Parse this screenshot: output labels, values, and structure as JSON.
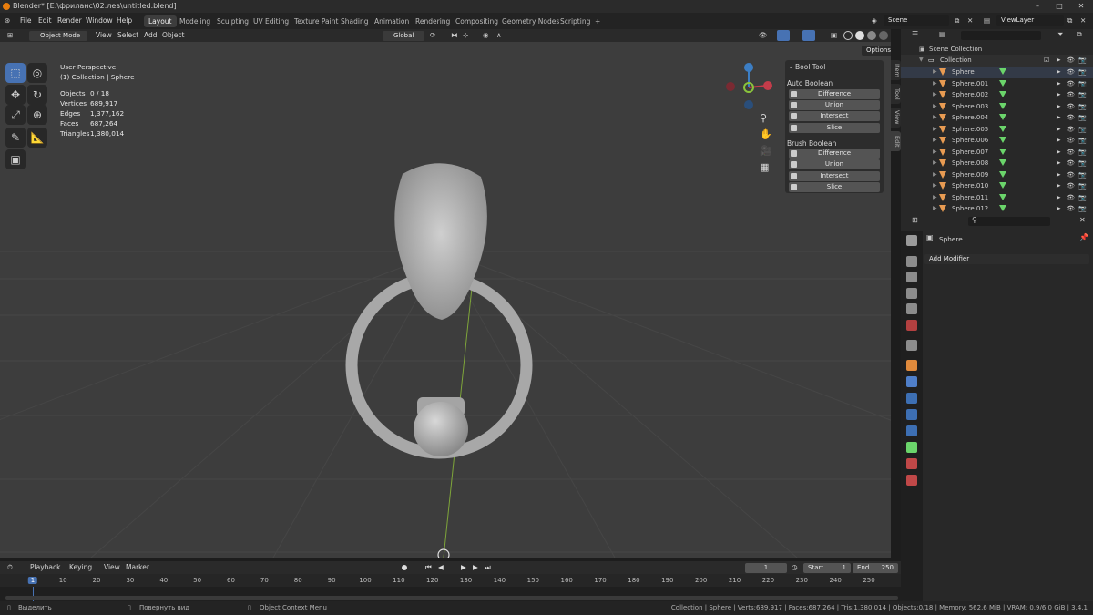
{
  "window": {
    "title": "Blender* [E:\\фриланс\\02.лев\\untitled.blend]"
  },
  "menu": [
    "File",
    "Edit",
    "Render",
    "Window",
    "Help"
  ],
  "workspaces": [
    "Layout",
    "Modeling",
    "Sculpting",
    "UV Editing",
    "Texture Paint",
    "Shading",
    "Animation",
    "Rendering",
    "Compositing",
    "Geometry Nodes",
    "Scripting"
  ],
  "scene": {
    "label": "Scene",
    "view_layer": "ViewLayer"
  },
  "viewport_header": {
    "mode": "Object Mode",
    "menus": [
      "View",
      "Select",
      "Add",
      "Object"
    ],
    "transform": "Global",
    "options": "Options"
  },
  "overlay_text": {
    "view": "User Perspective",
    "collection": "(1) Collection | Sphere",
    "stats": [
      {
        "label": "Objects",
        "value": "0 / 18"
      },
      {
        "label": "Vertices",
        "value": "689,917"
      },
      {
        "label": "Edges",
        "value": "1,377,162"
      },
      {
        "label": "Faces",
        "value": "687,264"
      },
      {
        "label": "Triangles",
        "value": "1,380,014"
      }
    ]
  },
  "bool_tool": {
    "title": "Bool Tool",
    "auto_label": "Auto Boolean",
    "brush_label": "Brush Boolean",
    "ops": [
      "Difference",
      "Union",
      "Intersect",
      "Slice"
    ]
  },
  "side_tabs": [
    "Item",
    "Tool",
    "View",
    "Edit"
  ],
  "outliner": {
    "root": "Scene Collection",
    "collection": "Collection",
    "items": [
      "Sphere",
      "Sphere.001",
      "Sphere.002",
      "Sphere.003",
      "Sphere.004",
      "Sphere.005",
      "Sphere.006",
      "Sphere.007",
      "Sphere.008",
      "Sphere.009",
      "Sphere.010",
      "Sphere.011",
      "Sphere.012"
    ]
  },
  "properties": {
    "object": "Sphere",
    "add_modifier": "Add Modifier"
  },
  "timeline": {
    "menus": [
      "Playback",
      "Keying",
      "View",
      "Marker"
    ],
    "current_frame": "1",
    "start_label": "Start",
    "start": "1",
    "end_label": "End",
    "end": "250",
    "ticks": [
      "1",
      "10",
      "20",
      "30",
      "40",
      "50",
      "60",
      "70",
      "80",
      "90",
      "100",
      "110",
      "120",
      "130",
      "140",
      "150",
      "160",
      "170",
      "180",
      "190",
      "200",
      "210",
      "220",
      "230",
      "240",
      "250"
    ]
  },
  "status": {
    "select": "Выделить",
    "rotate": "Повернуть вид",
    "context": "Object Context Menu",
    "info": "Collection | Sphere | Verts:689,917 | Faces:687,264 | Tris:1,380,014 | Objects:0/18 | Memory: 562.6 MiB | VRAM: 0.9/6.0 GiB | 3.4.1"
  },
  "colors": {
    "accent": "#4772b3",
    "axis_x": "#c43c4a",
    "axis_y": "#8ac43c",
    "axis_z": "#3c7ec4",
    "mesh_icon": "#e89b52",
    "vgroup": "#6bd56b"
  }
}
